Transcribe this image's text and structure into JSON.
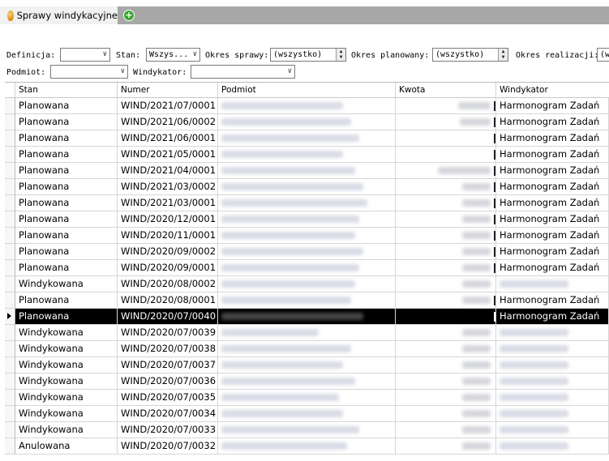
{
  "tab": {
    "title": "Sprawy windykacyjne",
    "add_icon": "plus-circle-icon"
  },
  "filters": {
    "definicja_label": "Definicja:",
    "definicja_value": "",
    "stan_label": "Stan:",
    "stan_value": "Wszys...",
    "okres_sprawy_label": "Okres sprawy:",
    "okres_sprawy_value": "(wszystko)",
    "okres_planowany_label": "Okres planowany:",
    "okres_planowany_value": "(wszystko)",
    "okres_realizacji_label": "Okres realizacji:",
    "okres_realizacji_value": "(w",
    "podmiot_label": "Podmiot:",
    "podmiot_value": "",
    "windykator_label": "Windykator:",
    "windykator_value": ""
  },
  "columns": [
    "Stan",
    "Numer",
    "Podmiot",
    "Kwota",
    "Windykator"
  ],
  "rows": [
    {
      "stan": "Planowana",
      "numer": "WIND/2021/07/0001",
      "windykator": "Harmonogram Zadań"
    },
    {
      "stan": "Planowana",
      "numer": "WIND/2021/06/0002",
      "windykator": "Harmonogram Zadań"
    },
    {
      "stan": "Planowana",
      "numer": "WIND/2021/06/0001",
      "windykator": "Harmonogram Zadań"
    },
    {
      "stan": "Planowana",
      "numer": "WIND/2021/05/0001",
      "windykator": "Harmonogram Zadań"
    },
    {
      "stan": "Planowana",
      "numer": "WIND/2021/04/0001",
      "windykator": "Harmonogram Zadań"
    },
    {
      "stan": "Planowana",
      "numer": "WIND/2021/03/0002",
      "windykator": "Harmonogram Zadań"
    },
    {
      "stan": "Planowana",
      "numer": "WIND/2021/03/0001",
      "windykator": "Harmonogram Zadań"
    },
    {
      "stan": "Planowana",
      "numer": "WIND/2020/12/0001",
      "windykator": "Harmonogram Zadań"
    },
    {
      "stan": "Planowana",
      "numer": "WIND/2020/11/0001",
      "windykator": "Harmonogram Zadań"
    },
    {
      "stan": "Planowana",
      "numer": "WIND/2020/09/0002",
      "windykator": "Harmonogram Zadań"
    },
    {
      "stan": "Planowana",
      "numer": "WIND/2020/09/0001",
      "windykator": "Harmonogram Zadań"
    },
    {
      "stan": "Windykowana",
      "numer": "WIND/2020/08/0002",
      "windykator": ""
    },
    {
      "stan": "Planowana",
      "numer": "WIND/2020/08/0001",
      "windykator": "Harmonogram Zadań"
    },
    {
      "stan": "Planowana",
      "numer": "WIND/2020/07/0040",
      "windykator": "Harmonogram Zadań",
      "selected": true
    },
    {
      "stan": "Windykowana",
      "numer": "WIND/2020/07/0039",
      "windykator": ""
    },
    {
      "stan": "Windykowana",
      "numer": "WIND/2020/07/0038",
      "windykator": ""
    },
    {
      "stan": "Windykowana",
      "numer": "WIND/2020/07/0037",
      "windykator": ""
    },
    {
      "stan": "Windykowana",
      "numer": "WIND/2020/07/0036",
      "windykator": ""
    },
    {
      "stan": "Windykowana",
      "numer": "WIND/2020/07/0035",
      "windykator": ""
    },
    {
      "stan": "Windykowana",
      "numer": "WIND/2020/07/0034",
      "windykator": ""
    },
    {
      "stan": "Windykowana",
      "numer": "WIND/2020/07/0033",
      "windykator": ""
    },
    {
      "stan": "Anulowana",
      "numer": "WIND/2020/07/0032",
      "windykator": ""
    }
  ]
}
